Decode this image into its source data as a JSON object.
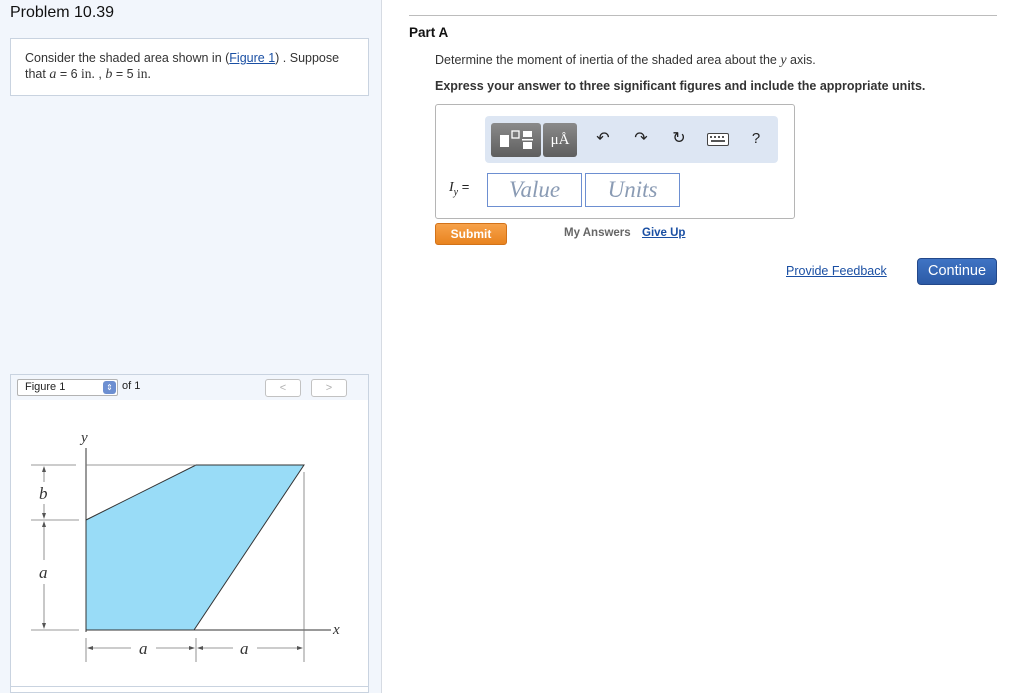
{
  "problem": {
    "title": "Problem 10.39"
  },
  "intro": {
    "text_before": "Consider the shaded area shown in (",
    "figure_link": "Figure 1",
    "text_after": ") . Suppose",
    "line2_prefix": "that",
    "a_var": "a",
    "eq": " = ",
    "a_value": "6",
    "unit": "in.",
    "comma": " , ",
    "b_var": "b",
    "b_value": "5"
  },
  "figure_nav": {
    "select_label": "Figure 1",
    "of_text": "of 1",
    "prev": "<",
    "next": ">"
  },
  "figure": {
    "labels": {
      "y": "y",
      "x": "x",
      "b": "b",
      "a_left": "a",
      "a_bottom1": "a",
      "a_bottom2": "a"
    },
    "fill_color": "#99dcf7"
  },
  "part": {
    "label": "Part A",
    "question_prefix": "Determine the moment of inertia of the shaded area about the ",
    "question_var": "y",
    "question_suffix": " axis.",
    "instructions": "Express your answer to three significant figures and include the appropriate units."
  },
  "answer": {
    "unit_button": "μÅ",
    "help": "?",
    "label_var": "I",
    "label_sub": "y",
    "label_eq": " =",
    "value_placeholder": "Value",
    "units_placeholder": "Units"
  },
  "actions": {
    "submit": "Submit",
    "my_answers": "My Answers",
    "give_up": "Give Up",
    "feedback": "Provide Feedback",
    "continue": "Continue"
  },
  "colors": {
    "accent": "#2c5aa6",
    "submit": "#e8831f",
    "link": "#1a4fa3"
  }
}
